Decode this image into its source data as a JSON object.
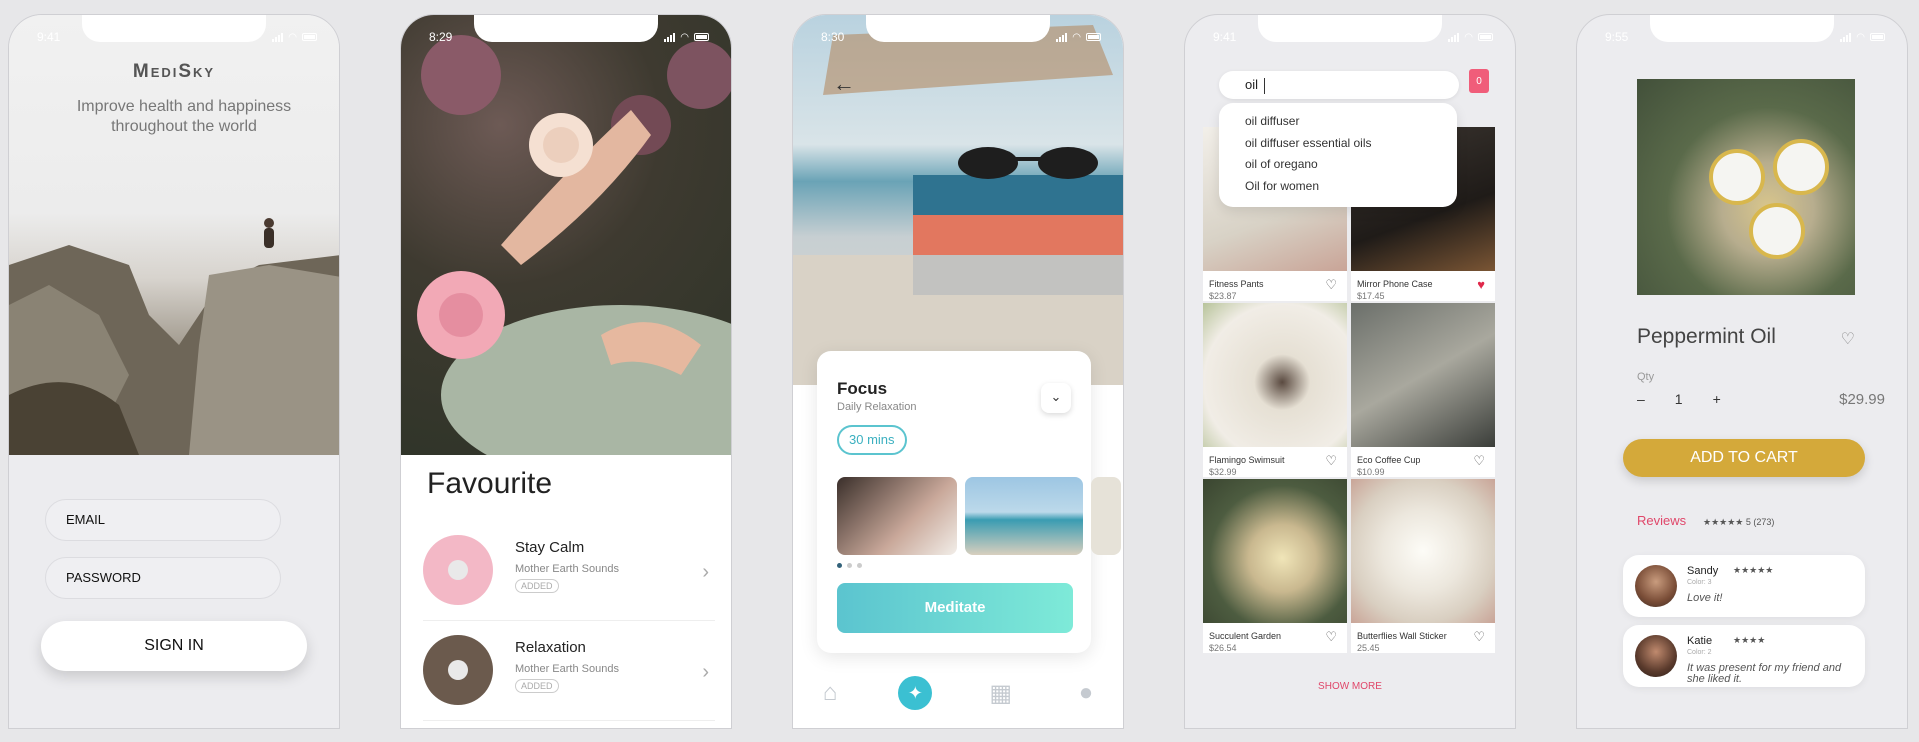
{
  "phones": {
    "login": {
      "time": "9:41",
      "brand": "MediSky",
      "tagline": "Improve health and happiness throughout the world",
      "email_placeholder": "EMAIL",
      "password_placeholder": "PASSWORD",
      "signin_label": "SIGN IN"
    },
    "favourite": {
      "time": "8:29",
      "title": "Favourite",
      "items": [
        {
          "name": "Stay Calm",
          "source": "Mother Earth Sounds",
          "tag": "ADDED",
          "disc_color": "#f3b8c6"
        },
        {
          "name": "Relaxation",
          "source": "Mother Earth Sounds",
          "tag": "ADDED",
          "disc_color": "#6b5a4d"
        }
      ]
    },
    "focus": {
      "time": "8:30",
      "title": "Focus",
      "subtitle": "Daily Relaxation",
      "duration": "30 mins",
      "cta": "Meditate",
      "accent": "#3bc0d2"
    },
    "shop": {
      "time": "9:41",
      "search_value": "oil",
      "cart_count": "0",
      "suggestions": [
        "oil diffuser",
        "oil diffuser essential oils",
        "oil of oregano",
        "Oil for women"
      ],
      "products": [
        {
          "name": "Fitness Pants",
          "price": "$23.87",
          "liked": false
        },
        {
          "name": "Mirror Phone Case",
          "price": "$17.45",
          "liked": true
        },
        {
          "name": "Flamingo Swimsuit",
          "price": "$32.99",
          "liked": false
        },
        {
          "name": "Eco Coffee Cup",
          "price": "$10.99",
          "liked": false
        },
        {
          "name": "Succulent Garden",
          "price": "$26.54",
          "liked": false
        },
        {
          "name": "Butterflies Wall Sticker",
          "price": "25.45",
          "liked": false
        }
      ],
      "show_more": "SHOW MORE"
    },
    "product": {
      "time": "9:55",
      "name": "Peppermint Oil",
      "qty_label": "Qty",
      "qty_minus": "–",
      "qty_value": "1",
      "qty_plus": "+",
      "price": "$29.99",
      "add_to_cart": "ADD TO CART",
      "reviews_label": "Reviews",
      "rating_summary": "★★★★★ 5 (273)",
      "reviews": [
        {
          "name": "Sandy",
          "stars": "★★★★★",
          "color": "Color: 3",
          "text": "Love it!"
        },
        {
          "name": "Katie",
          "stars": "★★★★",
          "color": "Color: 2",
          "text": "It was present for my friend and she liked it."
        }
      ]
    }
  }
}
